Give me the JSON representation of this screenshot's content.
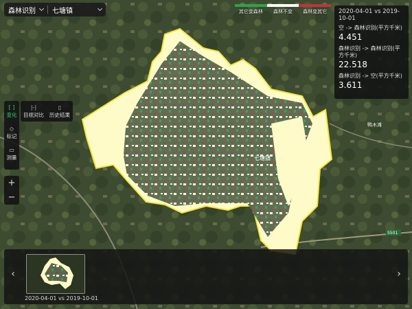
{
  "selector": {
    "category": "森林识别",
    "town": "七塘镇"
  },
  "legend": {
    "items": [
      {
        "label": "其它变森林",
        "color": "#2fa24a"
      },
      {
        "label": "森林不变",
        "color": "#ffffff"
      },
      {
        "label": "森林变其它",
        "color": "#c2333a"
      }
    ]
  },
  "stats": {
    "period": "2020-04-01 vs 2019-10-01",
    "rows": [
      {
        "label": "空 -> 森林识别(平方千米)",
        "value": "4.451"
      },
      {
        "label": "森林识别 -> 森林识别(平方千米)",
        "value": "22.518"
      },
      {
        "label": "森林识别 -> 空(平方千米)",
        "value": "3.611"
      }
    ]
  },
  "tools": {
    "change": "变化",
    "mark": "标记",
    "measure": "测量",
    "compare": "目视对比",
    "history": "历史结果",
    "zoom_in": "+",
    "zoom_out": "−",
    "change_icon": "change-icon",
    "mark_icon": "tag-icon",
    "measure_icon": "ruler-icon",
    "compare_icon": "compare-icon",
    "history_icon": "document-icon"
  },
  "map_labels": {
    "town": "七塘镇",
    "north": "鸭木滩",
    "road": "S501",
    "bottom_left": "大石..."
  },
  "timeline": {
    "items": [
      {
        "label": "2020-04-01 vs 2019-10-01"
      }
    ],
    "prev": "‹",
    "next": "›"
  },
  "colors": {
    "accent": "#31d07a",
    "region_fill": "#fffbc8",
    "boundary": "#f5e63a"
  }
}
